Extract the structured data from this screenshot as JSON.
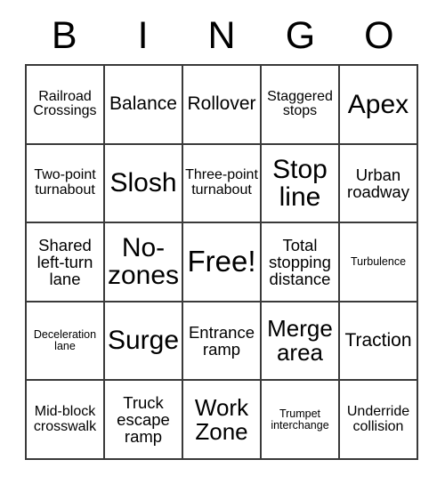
{
  "card": {
    "header": {
      "letters": [
        "B",
        "I",
        "N",
        "G",
        "O"
      ]
    },
    "rows": [
      {
        "cells": [
          {
            "text": "Railroad Crossings",
            "size": "sm"
          },
          {
            "text": "Balance",
            "size": "lg"
          },
          {
            "text": "Rollover",
            "size": "lg"
          },
          {
            "text": "Staggered stops",
            "size": "sm"
          },
          {
            "text": "Apex",
            "size": "xxl"
          }
        ]
      },
      {
        "cells": [
          {
            "text": "Two-point turnabout",
            "size": "sm"
          },
          {
            "text": "Slosh",
            "size": "xxl"
          },
          {
            "text": "Three-point turnabout",
            "size": "sm"
          },
          {
            "text": "Stop line",
            "size": "xxl"
          },
          {
            "text": "Urban roadway",
            "size": "md"
          }
        ]
      },
      {
        "cells": [
          {
            "text": "Shared left-turn lane",
            "size": "md"
          },
          {
            "text": "No-zones",
            "size": "xxl"
          },
          {
            "text": "Free!",
            "size": "huge"
          },
          {
            "text": "Total stopping distance",
            "size": "md"
          },
          {
            "text": "Turbulence",
            "size": "xs"
          }
        ]
      },
      {
        "cells": [
          {
            "text": "Deceleration lane",
            "size": "xs"
          },
          {
            "text": "Surge",
            "size": "xxl"
          },
          {
            "text": "Entrance ramp",
            "size": "md"
          },
          {
            "text": "Merge area",
            "size": "xl"
          },
          {
            "text": "Traction",
            "size": "lg"
          }
        ]
      },
      {
        "cells": [
          {
            "text": "Mid-block crosswalk",
            "size": "sm"
          },
          {
            "text": "Truck escape ramp",
            "size": "md"
          },
          {
            "text": "Work Zone",
            "size": "xl"
          },
          {
            "text": "Trumpet interchange",
            "size": "xs"
          },
          {
            "text": "Underride collision",
            "size": "sm"
          }
        ]
      }
    ]
  }
}
